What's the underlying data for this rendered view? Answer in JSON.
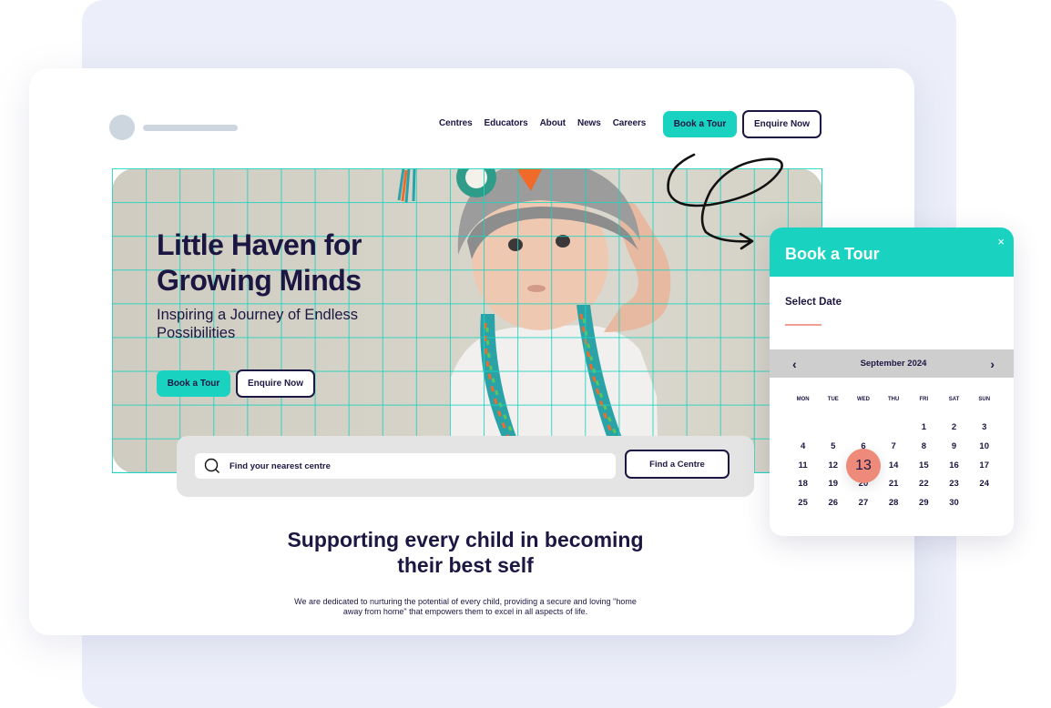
{
  "background": {
    "panel_color": "#eceef9",
    "accent_teal": "#19d3c0",
    "navy": "#1c1742",
    "coral": "#ed8a7a"
  },
  "nav": {
    "links": [
      "Centres",
      "Educators",
      "About",
      "News",
      "Careers"
    ],
    "book_tour": "Book a Tour",
    "enquire": "Enquire Now"
  },
  "hero": {
    "title_line1": "Little Haven for",
    "title_line2": "Growing Minds",
    "subtitle": "Inspiring a Journey of Endless Possibilities",
    "book_tour": "Book a Tour",
    "enquire": "Enquire Now"
  },
  "search": {
    "icon": "search-icon",
    "placeholder": "Find your nearest centre",
    "button": "Find a Centre"
  },
  "section": {
    "title_line1": "Supporting every child in becoming",
    "title_line2": "their best self",
    "body_line1": "We are dedicated to nurturing the potential of every child, providing a secure and loving \"home",
    "body_line2": "away from home\" that empowers them to excel in all aspects of life."
  },
  "calendar": {
    "title": "Book a Tour",
    "close": "×",
    "select_label": "Select Date",
    "month": "September 2024",
    "prev": "‹",
    "next": "›",
    "weekdays": [
      "MON",
      "TUE",
      "WED",
      "THU",
      "FRI",
      "SAT",
      "SUN"
    ],
    "leading_blanks": 4,
    "days": 30,
    "selected": 13
  }
}
